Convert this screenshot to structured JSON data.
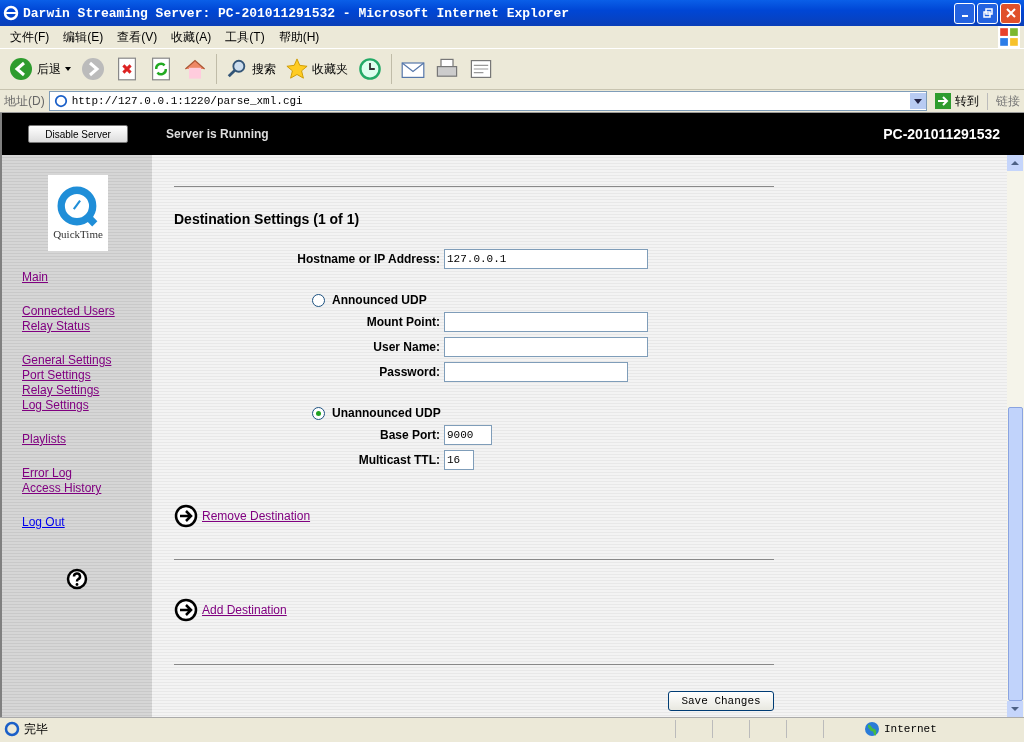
{
  "window": {
    "title": "Darwin Streaming Server: PC-201011291532 - Microsoft Internet Explorer"
  },
  "menu": [
    "文件(F)",
    "编辑(E)",
    "查看(V)",
    "收藏(A)",
    "工具(T)",
    "帮助(H)"
  ],
  "toolbar": {
    "back": "后退",
    "search": "搜索",
    "favorites": "收藏夹"
  },
  "address": {
    "label": "地址(D)",
    "url": "http://127.0.0.1:1220/parse_xml.cgi",
    "go": "转到",
    "links": "链接"
  },
  "header": {
    "button": "Disable Server",
    "status": "Server is Running",
    "host": "PC-201011291532"
  },
  "sidebar": {
    "logo": "QuickTime",
    "groups": [
      [
        {
          "label": "Main",
          "visited": true
        }
      ],
      [
        {
          "label": "Connected Users",
          "visited": true
        },
        {
          "label": "Relay Status",
          "visited": true
        }
      ],
      [
        {
          "label": "General Settings",
          "visited": true
        },
        {
          "label": "Port Settings",
          "visited": true
        },
        {
          "label": "Relay Settings",
          "visited": true
        },
        {
          "label": "Log Settings",
          "visited": true
        }
      ],
      [
        {
          "label": "Playlists",
          "visited": true
        }
      ],
      [
        {
          "label": "Error Log",
          "visited": true
        },
        {
          "label": "Access History",
          "visited": true
        }
      ],
      [
        {
          "label": "Log Out",
          "visited": false
        }
      ]
    ]
  },
  "destination": {
    "heading": "Destination Settings (1 of 1)",
    "host_field": {
      "label": "Hostname or IP Address:",
      "value": "127.0.0.1"
    },
    "modes": [
      {
        "label": "Announced UDP",
        "selected": false,
        "fields": [
          {
            "label": "Mount Point:"
          },
          {
            "label": "User Name:"
          },
          {
            "label": "Password:"
          }
        ]
      },
      {
        "label": "Unannounced UDP",
        "selected": true,
        "fields": [
          {
            "label": "Base Port:",
            "value": "9000"
          },
          {
            "label": "Multicast TTL:",
            "value": "16"
          }
        ]
      }
    ],
    "remove": "Remove Destination"
  },
  "add": "Add Destination",
  "save": "Save Changes",
  "status_bar": {
    "text": "完毕",
    "zone": "Internet"
  }
}
